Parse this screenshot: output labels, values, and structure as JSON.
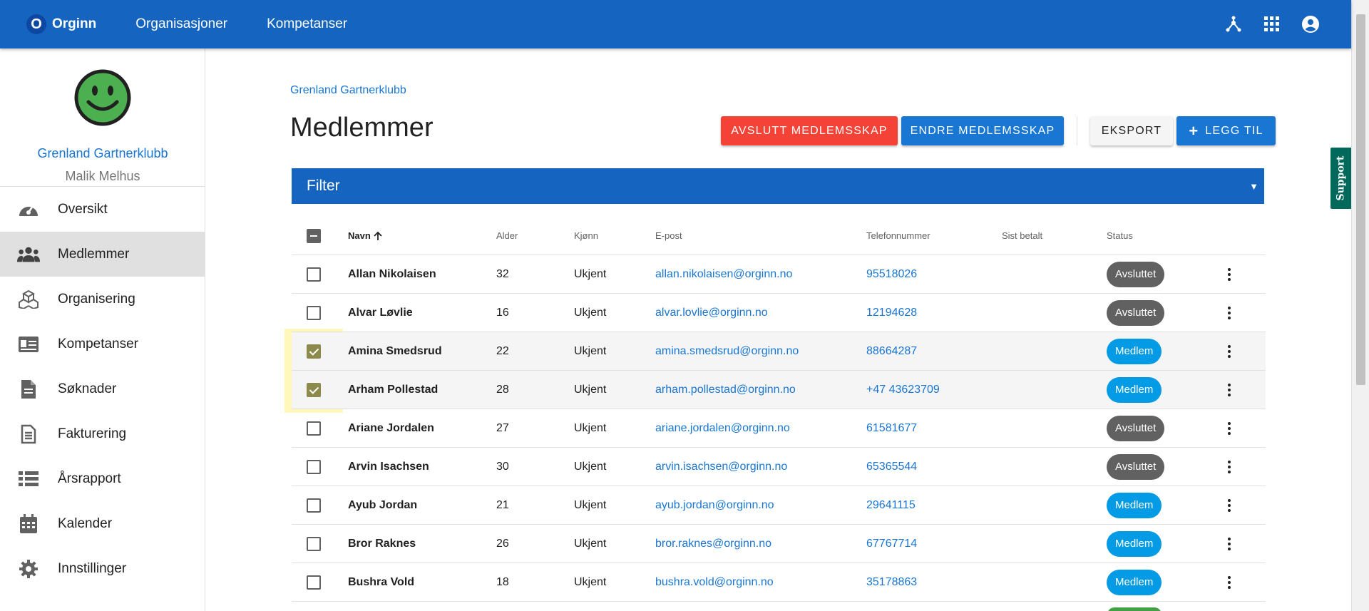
{
  "topbar": {
    "logo_letter": "O",
    "brand": "Orginn",
    "nav": [
      "Organisasjoner",
      "Kompetanser"
    ],
    "icons": [
      "hub-icon",
      "apps-grid-icon",
      "account-circle-icon"
    ]
  },
  "sidebar": {
    "org_name": "Grenland Gartnerklubb",
    "user_name": "Malik Melhus",
    "items": [
      {
        "label": "Oversikt",
        "icon": "speedometer-icon"
      },
      {
        "label": "Medlemmer",
        "icon": "people-icon"
      },
      {
        "label": "Organisering",
        "icon": "boxes-icon"
      },
      {
        "label": "Kompetanser",
        "icon": "id-card-icon"
      },
      {
        "label": "Søknader",
        "icon": "document-icon"
      },
      {
        "label": "Fakturering",
        "icon": "invoice-icon"
      },
      {
        "label": "Årsrapport",
        "icon": "list-icon"
      },
      {
        "label": "Kalender",
        "icon": "calendar-icon"
      },
      {
        "label": "Innstillinger",
        "icon": "gear-icon"
      }
    ],
    "active_index": 1
  },
  "main": {
    "breadcrumb": "Grenland Gartnerklubb",
    "title": "Medlemmer",
    "buttons": {
      "end_membership": "Avslutt medlemsskap",
      "change_membership": "Endre medlemsskap",
      "export": "Eksport",
      "add": "Legg til"
    },
    "filter": "Filter"
  },
  "table": {
    "headers": {
      "name": "Navn",
      "age": "Alder",
      "gender": "Kjønn",
      "email": "E-post",
      "phone": "Telefonnummer",
      "last_paid": "Sist betalt",
      "status": "Status"
    },
    "rows": [
      {
        "name": "Allan Nikolaisen",
        "age": "32",
        "gender": "Ukjent",
        "email": "allan.nikolaisen@orginn.no",
        "phone": "95518026",
        "last_paid": "",
        "status": "Avsluttet",
        "checked": false
      },
      {
        "name": "Alvar Løvlie",
        "age": "16",
        "gender": "Ukjent",
        "email": "alvar.lovlie@orginn.no",
        "phone": "12194628",
        "last_paid": "",
        "status": "Avsluttet",
        "checked": false
      },
      {
        "name": "Amina Smedsrud",
        "age": "22",
        "gender": "Ukjent",
        "email": "amina.smedsrud@orginn.no",
        "phone": "88664287",
        "last_paid": "",
        "status": "Medlem",
        "checked": true
      },
      {
        "name": "Arham Pollestad",
        "age": "28",
        "gender": "Ukjent",
        "email": "arham.pollestad@orginn.no",
        "phone": "+47 43623709",
        "last_paid": "",
        "status": "Medlem",
        "checked": true
      },
      {
        "name": "Ariane Jordalen",
        "age": "27",
        "gender": "Ukjent",
        "email": "ariane.jordalen@orginn.no",
        "phone": "61581677",
        "last_paid": "",
        "status": "Avsluttet",
        "checked": false
      },
      {
        "name": "Arvin Isachsen",
        "age": "30",
        "gender": "Ukjent",
        "email": "arvin.isachsen@orginn.no",
        "phone": "65365544",
        "last_paid": "",
        "status": "Avsluttet",
        "checked": false
      },
      {
        "name": "Ayub Jordan",
        "age": "21",
        "gender": "Ukjent",
        "email": "ayub.jordan@orginn.no",
        "phone": "29641115",
        "last_paid": "",
        "status": "Medlem",
        "checked": false
      },
      {
        "name": "Bror Raknes",
        "age": "26",
        "gender": "Ukjent",
        "email": "bror.raknes@orginn.no",
        "phone": "67767714",
        "last_paid": "",
        "status": "Medlem",
        "checked": false
      },
      {
        "name": "Bushra Vold",
        "age": "18",
        "gender": "Ukjent",
        "email": "bushra.vold@orginn.no",
        "phone": "35178863",
        "last_paid": "",
        "status": "Medlem",
        "checked": false
      }
    ]
  },
  "support": "Support",
  "colors": {
    "primary": "#1565c0",
    "danger": "#f44336",
    "member_chip": "#039be5",
    "ended_chip": "#616161",
    "support": "#00695c"
  }
}
